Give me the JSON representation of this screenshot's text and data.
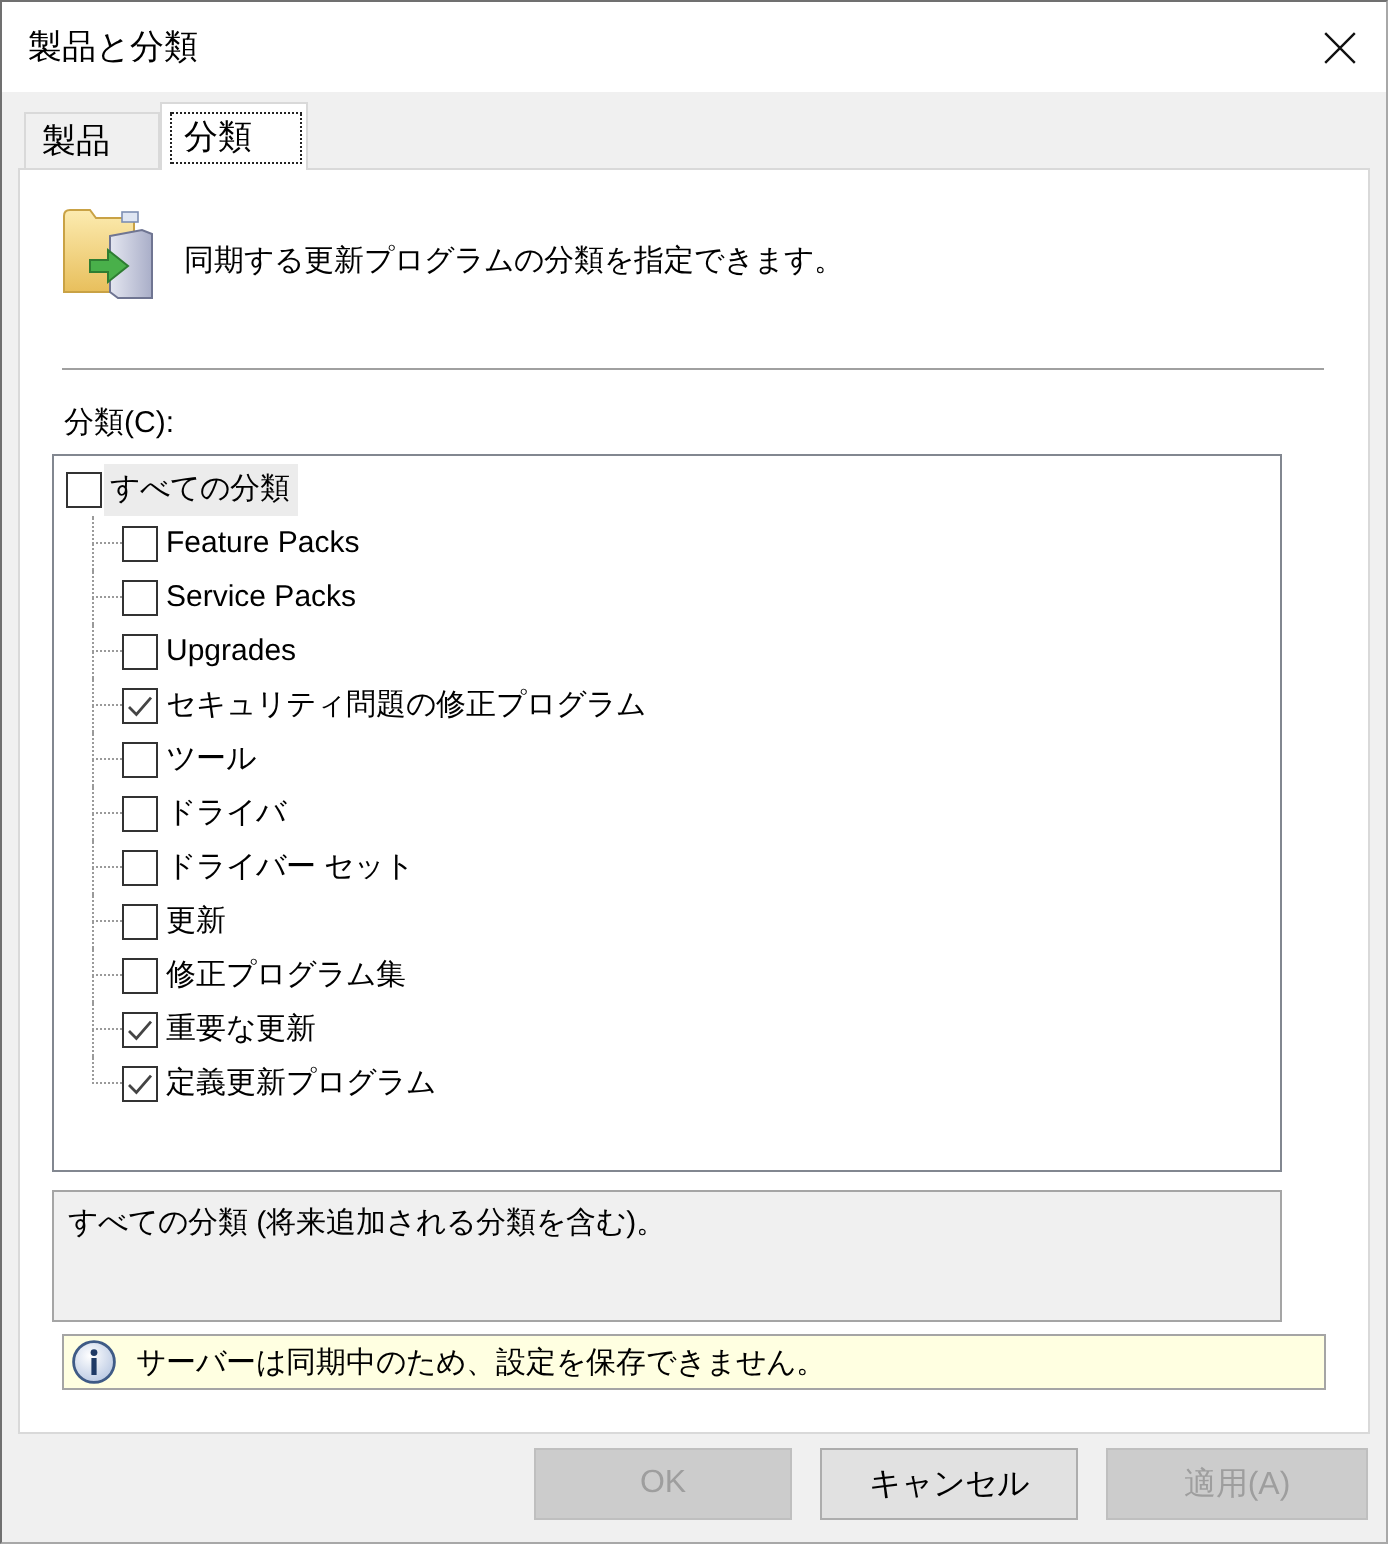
{
  "window": {
    "title": "製品と分類"
  },
  "tabs": [
    {
      "label": "製品",
      "selected": false
    },
    {
      "label": "分類",
      "selected": true
    }
  ],
  "header": {
    "text": "同期する更新プログラムの分類を指定できます。"
  },
  "classifications": {
    "label": "分類(C):",
    "tree": [
      {
        "label": "すべての分類",
        "checked": false,
        "selected": true,
        "children": [
          {
            "label": "Feature Packs",
            "checked": false,
            "selected": false
          },
          {
            "label": "Service Packs",
            "checked": false,
            "selected": false
          },
          {
            "label": "Upgrades",
            "checked": false,
            "selected": false
          },
          {
            "label": "セキュリティ問題の修正プログラム",
            "checked": true,
            "selected": false
          },
          {
            "label": "ツール",
            "checked": false,
            "selected": false
          },
          {
            "label": "ドライバ",
            "checked": false,
            "selected": false
          },
          {
            "label": "ドライバー セット",
            "checked": false,
            "selected": false
          },
          {
            "label": "更新",
            "checked": false,
            "selected": false
          },
          {
            "label": "修正プログラム集",
            "checked": false,
            "selected": false
          },
          {
            "label": "重要な更新",
            "checked": true,
            "selected": false
          },
          {
            "label": "定義更新プログラム",
            "checked": true,
            "selected": false
          }
        ]
      }
    ]
  },
  "description": {
    "text": "すべての分類 (将来追加される分類を含む)。"
  },
  "info_bar": {
    "text": "サーバーは同期中のため、設定を保存できません。"
  },
  "buttons": [
    {
      "label": "OK",
      "disabled": true
    },
    {
      "label": "キャンセル",
      "disabled": false
    },
    {
      "label": "適用(A)",
      "disabled": true
    }
  ]
}
